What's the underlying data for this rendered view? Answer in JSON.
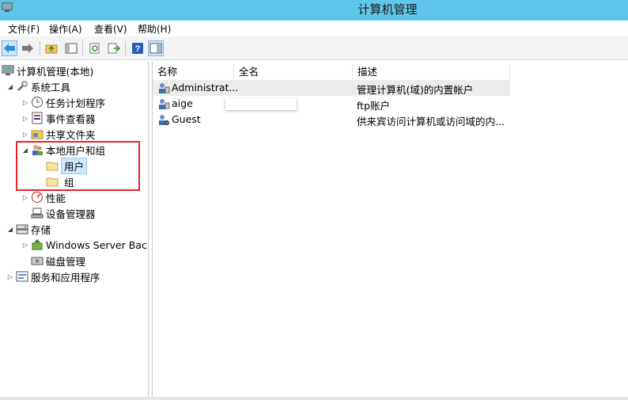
{
  "window": {
    "title": "计算机管理"
  },
  "menu": [
    {
      "label": "文件(F)"
    },
    {
      "label": "操作(A)"
    },
    {
      "label": "查看(V)"
    },
    {
      "label": "帮助(H)"
    }
  ],
  "tree": {
    "root": "计算机管理(本地)",
    "system_tools": "系统工具",
    "task_scheduler": "任务计划程序",
    "event_viewer": "事件查看器",
    "shared_folders": "共享文件夹",
    "local_users_groups": "本地用户和组",
    "users": "用户",
    "groups": "组",
    "performance": "性能",
    "device_manager": "设备管理器",
    "storage": "存储",
    "windows_server_backup": "Windows Server Back",
    "disk_management": "磁盘管理",
    "services_apps": "服务和应用程序"
  },
  "list": {
    "columns": [
      "名称",
      "全名",
      "描述"
    ],
    "rows": [
      {
        "name": "Administrat...",
        "fullname": "",
        "description": "管理计算机(域)的内置帐户"
      },
      {
        "name": "aige",
        "fullname": "",
        "description": "ftp账户"
      },
      {
        "name": "Guest",
        "fullname": "",
        "description": "供来宾访问计算机或访问域的内..."
      }
    ]
  },
  "colors": {
    "titlebar": "#5fc6ea",
    "highlight": "#e8222a",
    "selection": "#cce8ff"
  }
}
